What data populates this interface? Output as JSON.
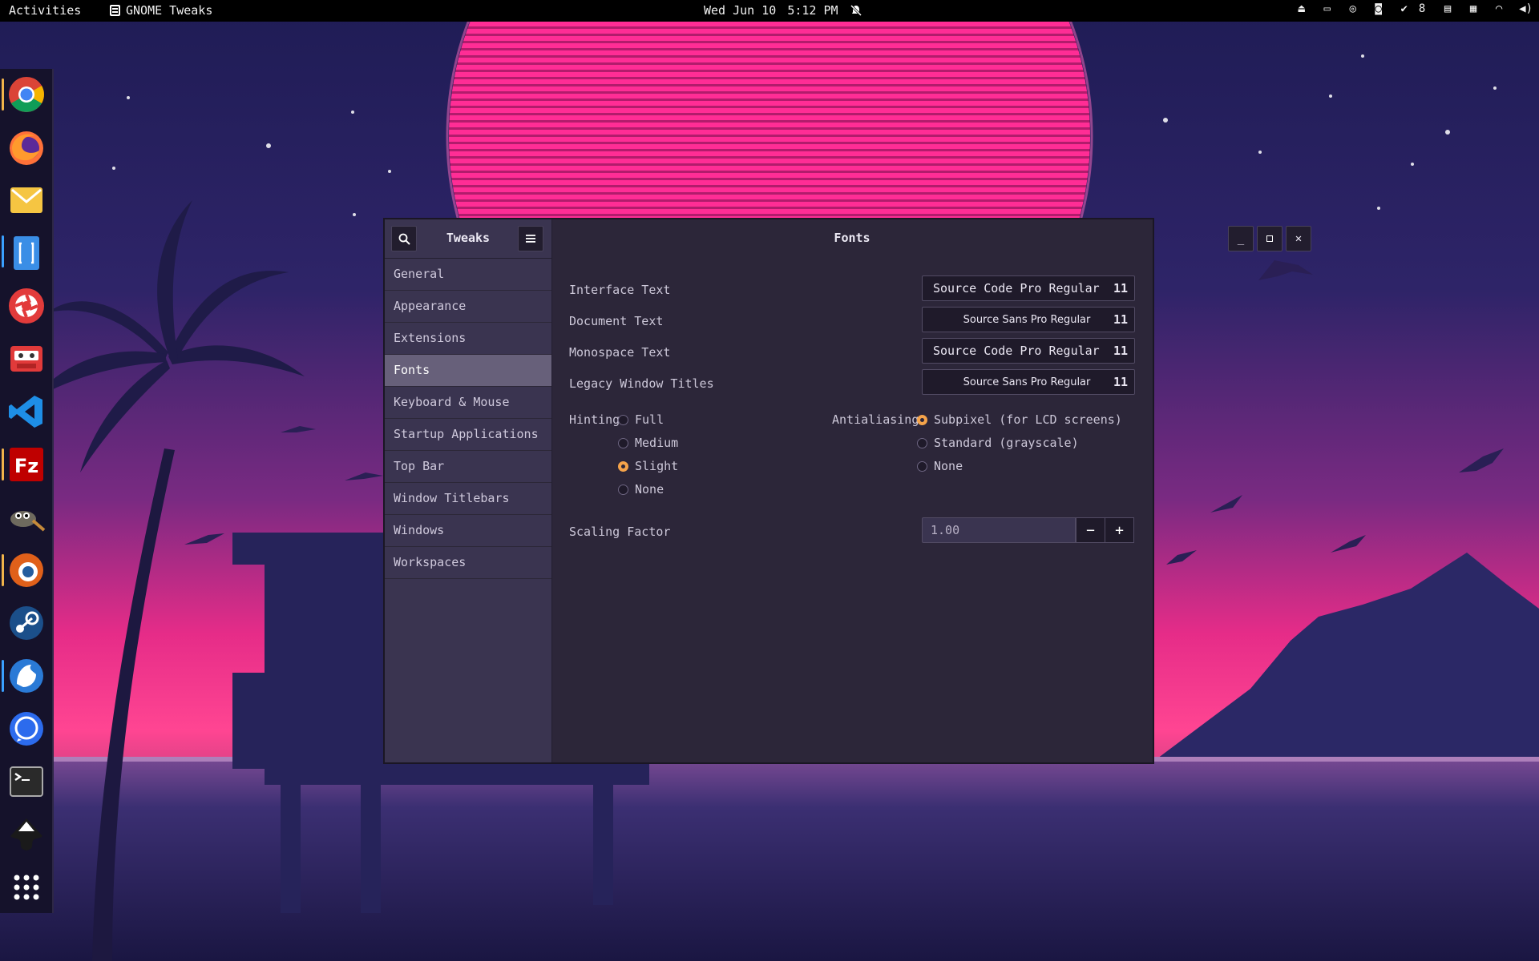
{
  "topbar": {
    "activities": "Activities",
    "app_name": "GNOME Tweaks",
    "date": "Wed Jun 10",
    "time": "5:12 PM",
    "updates_count": "8"
  },
  "dock": {
    "apps": [
      "chrome",
      "firefox",
      "mail",
      "text-editor",
      "shutter",
      "cassette",
      "vscode",
      "filezilla",
      "gimp",
      "blender",
      "steam",
      "thunderbird",
      "signal",
      "terminal",
      "inkscape",
      "app-grid"
    ]
  },
  "window": {
    "sidebar_title": "Tweaks",
    "main_title": "Fonts",
    "sidebar_items": [
      {
        "label": "General",
        "selected": false
      },
      {
        "label": "Appearance",
        "selected": false
      },
      {
        "label": "Extensions",
        "selected": false
      },
      {
        "label": "Fonts",
        "selected": true
      },
      {
        "label": "Keyboard & Mouse",
        "selected": false
      },
      {
        "label": "Startup Applications",
        "selected": false
      },
      {
        "label": "Top Bar",
        "selected": false
      },
      {
        "label": "Window Titlebars",
        "selected": false
      },
      {
        "label": "Windows",
        "selected": false
      },
      {
        "label": "Workspaces",
        "selected": false
      }
    ],
    "fonts": [
      {
        "label": "Interface Text",
        "font": "Source Code Pro Regular",
        "size": "11"
      },
      {
        "label": "Document Text",
        "font": "Source Sans Pro Regular",
        "size": "11"
      },
      {
        "label": "Monospace Text",
        "font": "Source Code Pro Regular",
        "size": "11"
      },
      {
        "label": "Legacy Window Titles",
        "font": "Source Sans Pro Regular",
        "size": "11"
      }
    ],
    "hinting": {
      "label": "Hinting",
      "options": [
        "Full",
        "Medium",
        "Slight",
        "None"
      ],
      "selected": "Slight"
    },
    "antialiasing": {
      "label": "Antialiasing",
      "options": [
        "Subpixel (for LCD screens)",
        "Standard (grayscale)",
        "None"
      ],
      "selected": "Subpixel (for LCD screens)"
    },
    "scaling": {
      "label": "Scaling Factor",
      "value": "1.00",
      "minus": "−",
      "plus": "+"
    }
  },
  "colors": {
    "accent_radio": "#f5a34a",
    "sun": "#ff2d95",
    "sky_top": "#1e1a4f",
    "sky_horizon": "#ff3c8e"
  }
}
